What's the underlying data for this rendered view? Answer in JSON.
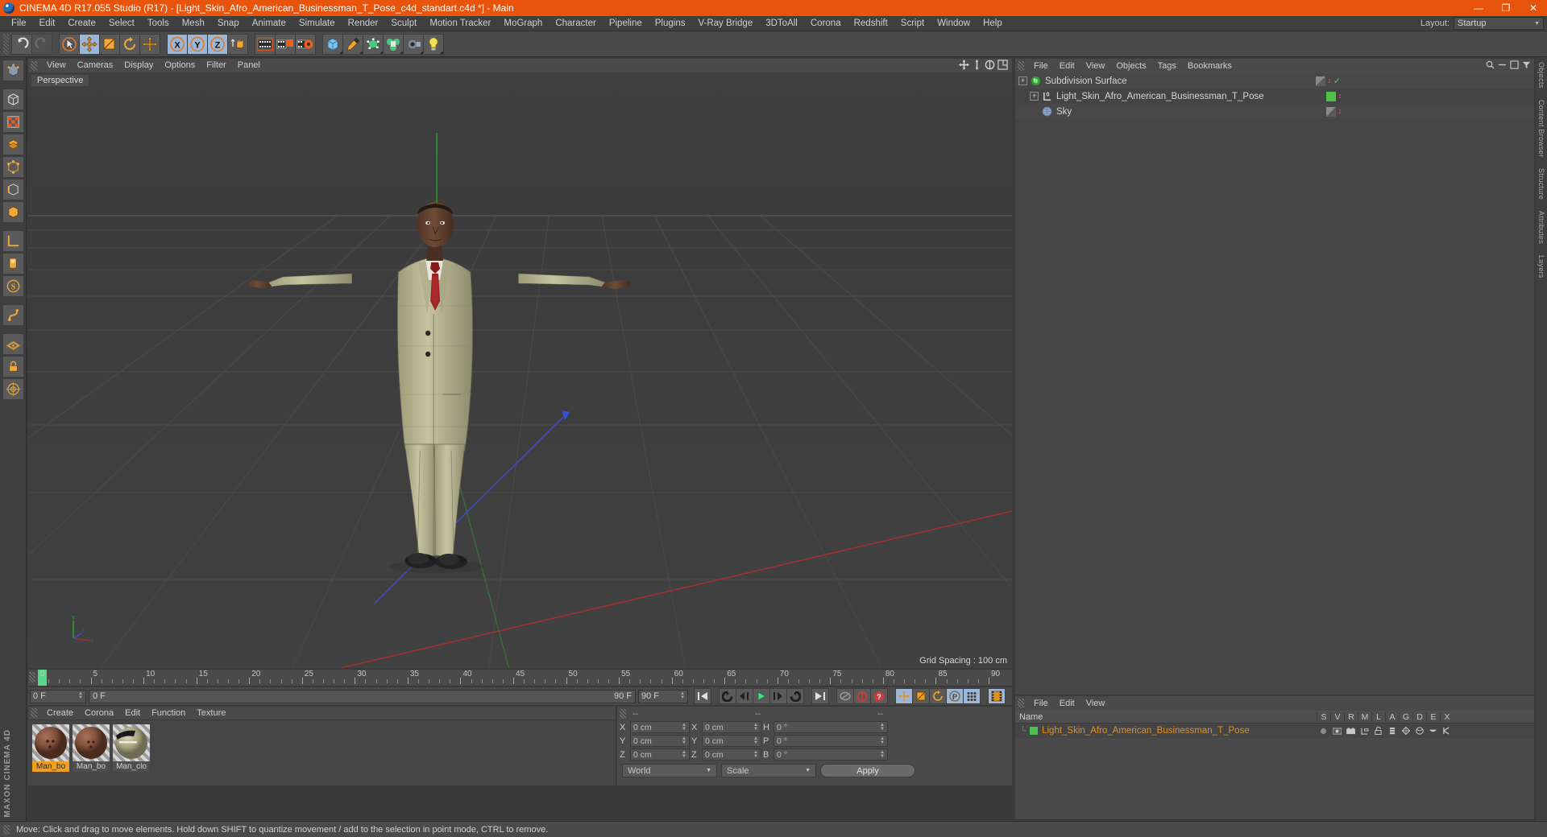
{
  "window": {
    "title": "CINEMA 4D R17.055 Studio (R17) - [Light_Skin_Afro_American_Businessman_T_Pose_c4d_standart.c4d *] - Main",
    "minimize": "—",
    "maximize": "❐",
    "close": "✕"
  },
  "menubar": {
    "items": [
      "File",
      "Edit",
      "Create",
      "Select",
      "Tools",
      "Mesh",
      "Snap",
      "Animate",
      "Simulate",
      "Render",
      "Sculpt",
      "Motion Tracker",
      "MoGraph",
      "Character",
      "Pipeline",
      "Plugins",
      "V-Ray Bridge",
      "3DToAll",
      "Corona",
      "Redshift",
      "Script",
      "Window",
      "Help"
    ],
    "layout_label": "Layout:",
    "layout_value": "Startup"
  },
  "viewport": {
    "menu": [
      "View",
      "Cameras",
      "Display",
      "Options",
      "Filter",
      "Panel"
    ],
    "camera_label": "Perspective",
    "grid_spacing": "Grid Spacing : 100 cm",
    "axis_x": "X",
    "axis_y": "Y",
    "axis_z": "Z"
  },
  "timeline": {
    "ticks": [
      0,
      5,
      10,
      15,
      20,
      25,
      30,
      35,
      40,
      45,
      50,
      55,
      60,
      65,
      70,
      75,
      80,
      85,
      90
    ],
    "current_frame_field": "0 F",
    "scrub_start": "0 F",
    "scrub_end": "90 F",
    "end_frame_field": "90 F",
    "playhead_frame": 0
  },
  "material_manager": {
    "menu": [
      "Create",
      "Corona",
      "Edit",
      "Function",
      "Texture"
    ],
    "materials": [
      {
        "name": "Man_bo",
        "selected": true
      },
      {
        "name": "Man_bo",
        "selected": false
      },
      {
        "name": "Man_clo",
        "selected": false
      }
    ]
  },
  "coordinates": {
    "headers": [
      "--",
      "--",
      "--"
    ],
    "rows": [
      {
        "l1": "X",
        "v1": "0 cm",
        "l2": "X",
        "v2": "0 cm",
        "l3": "H",
        "v3": "0 °"
      },
      {
        "l1": "Y",
        "v1": "0 cm",
        "l2": "Y",
        "v2": "0 cm",
        "l3": "P",
        "v3": "0 °"
      },
      {
        "l1": "Z",
        "v1": "0 cm",
        "l2": "Z",
        "v2": "0 cm",
        "l3": "B",
        "v3": "0 °"
      }
    ],
    "system": "World",
    "mode": "Scale",
    "apply": "Apply"
  },
  "object_manager": {
    "menu": [
      "File",
      "Edit",
      "View",
      "Objects",
      "Tags",
      "Bookmarks"
    ],
    "objects": [
      {
        "name": "Subdivision Surface",
        "indent": 0,
        "icon": "subdivision-surface-icon",
        "tag": "gray",
        "dots": "red",
        "check": true
      },
      {
        "name": "Light_Skin_Afro_American_Businessman_T_Pose",
        "indent": 1,
        "icon": "null-object-icon",
        "tag": "green",
        "dots": "red",
        "check": false
      },
      {
        "name": "Sky",
        "indent": 1,
        "icon": "sky-icon",
        "tag": "gray",
        "dots": "red",
        "check": false
      }
    ]
  },
  "layer_manager": {
    "menu": [
      "File",
      "Edit",
      "View"
    ],
    "name_header": "Name",
    "columns": [
      "S",
      "V",
      "R",
      "M",
      "L",
      "A",
      "G",
      "D",
      "E",
      "X"
    ],
    "rows": [
      {
        "name": "Light_Skin_Afro_American_Businessman_T_Pose"
      }
    ]
  },
  "edge_tabs": [
    "Objects",
    "Content Browser",
    "Structure",
    "Attributes",
    "Layers"
  ],
  "statusbar": {
    "text": "Move: Click and drag to move elements. Hold down SHIFT to quantize movement / add to the selection in point mode, CTRL to remove."
  },
  "colors": {
    "title_bar": "#e8540c",
    "selection": "#f0a020",
    "accent_green": "#4cc24c",
    "panel": "#4a4a4a"
  }
}
